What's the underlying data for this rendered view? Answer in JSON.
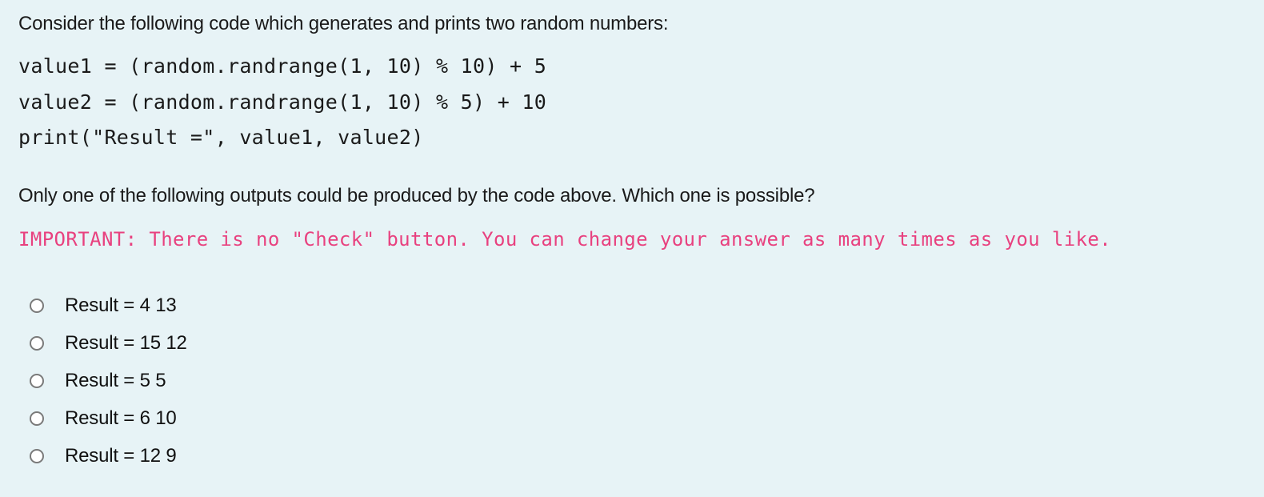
{
  "question": {
    "intro": "Consider the following code which generates and prints two random numbers:",
    "code_lines": [
      "value1 = (random.randrange(1, 10) % 10) + 5",
      "value2 = (random.randrange(1, 10) % 5) + 10",
      "print(\"Result =\", value1, value2)"
    ],
    "prompt": "Only one of the following outputs could be produced by the code above. Which one is possible?",
    "important_note": "IMPORTANT: There is no \"Check\" button. You can change your answer as many times as you like.",
    "important_color": "#e8417f",
    "options": [
      {
        "label": "Result = 4 13",
        "selected": false
      },
      {
        "label": "Result = 15 12",
        "selected": false
      },
      {
        "label": "Result = 5 5",
        "selected": false
      },
      {
        "label": "Result = 6 10",
        "selected": false
      },
      {
        "label": "Result = 12 9",
        "selected": false
      }
    ]
  }
}
